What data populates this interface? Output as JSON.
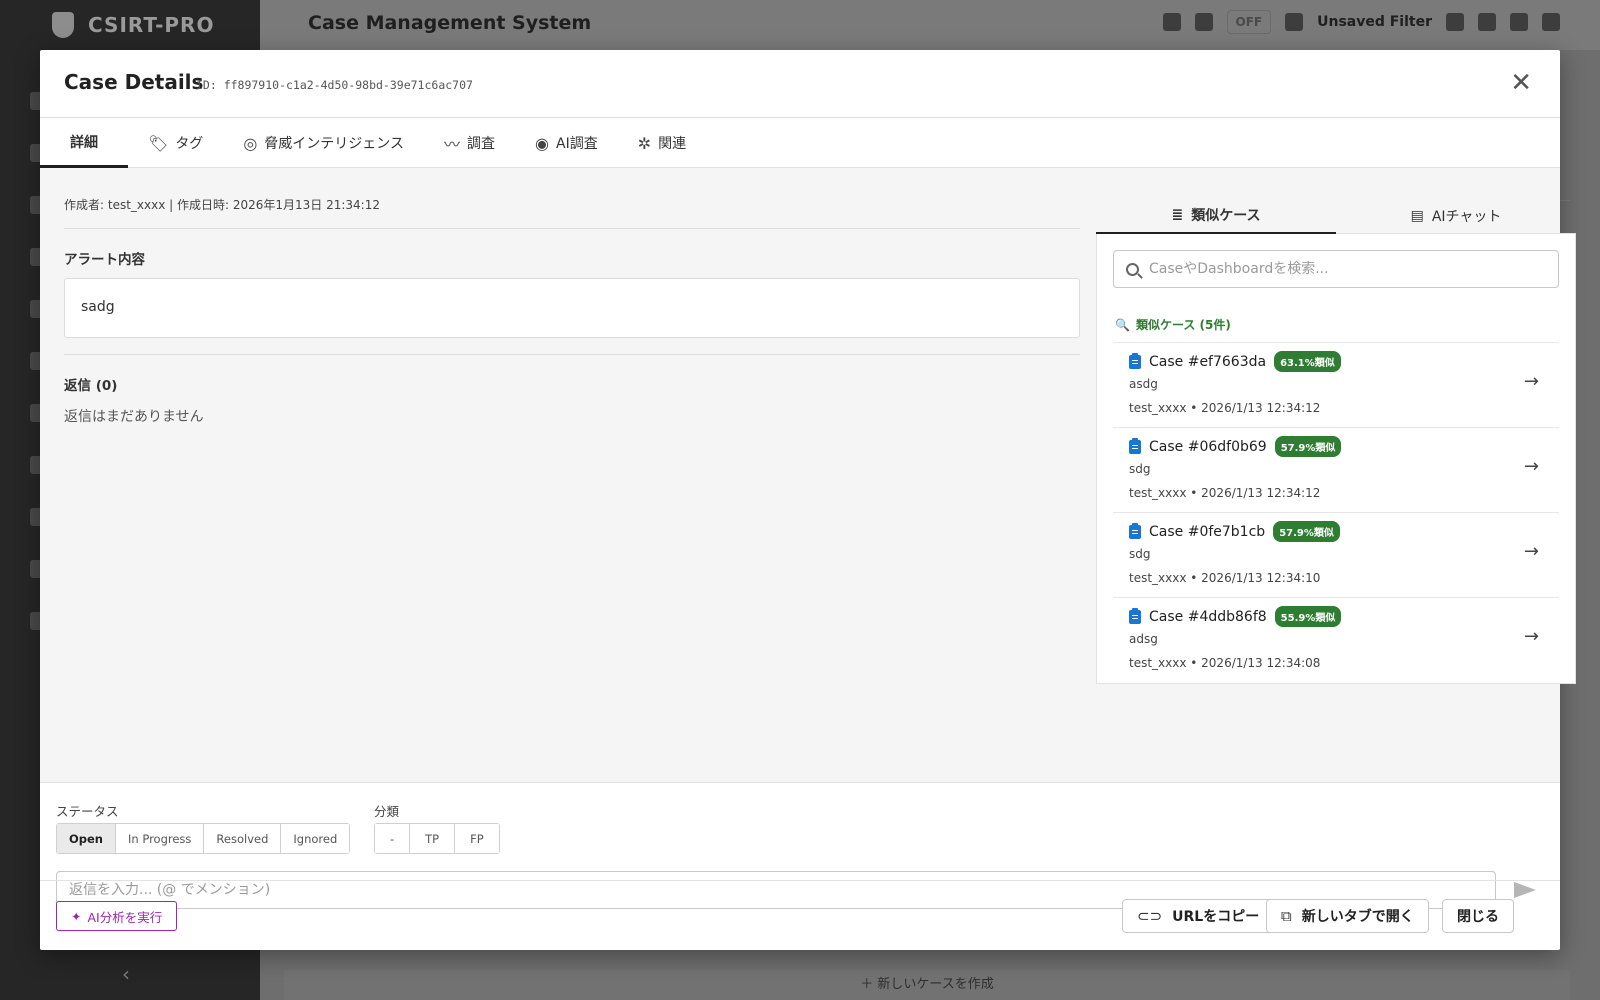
{
  "app": {
    "brand": "CSIRT-PRO",
    "title": "Case Management System",
    "toggle_label": "OFF",
    "filter_label": "Unsaved Filter",
    "create_case_label": "＋ 新しいケースを作成"
  },
  "modal": {
    "title": "Case Details",
    "case_id": "ID: ff897910-c1a2-4d50-98bd-39e71c6ac707",
    "tabs": [
      {
        "label": "詳細",
        "icon": "none"
      },
      {
        "label": "タグ",
        "icon": "tag-icon"
      },
      {
        "label": "脅威インテリジェンス",
        "icon": "target-icon"
      },
      {
        "label": "調査",
        "icon": "trend-icon"
      },
      {
        "label": "AI調査",
        "icon": "brain-icon"
      },
      {
        "label": "関連",
        "icon": "hub-icon"
      }
    ],
    "meta": "作成者: test_xxxx | 作成日時: 2026年1月13日 21:34:12",
    "alert_label": "アラート内容",
    "alert_content": "sadg",
    "replies_label": "返信 (0)",
    "replies_empty": "返信はまだありません"
  },
  "right_panel": {
    "tabs": [
      {
        "label": "類似ケース",
        "icon": "similar-search-icon"
      },
      {
        "label": "AIチャット",
        "icon": "chat-icon"
      }
    ],
    "search_placeholder": "CaseやDashboardを検索...",
    "similar_header": "類似ケース (5件)",
    "cases": [
      {
        "title": "Case #ef7663da",
        "badge": "63.1%類似",
        "summary": "asdg",
        "meta": "test_xxxx • 2026/1/13 12:34:12"
      },
      {
        "title": "Case #06df0b69",
        "badge": "57.9%類似",
        "summary": "sdg",
        "meta": "test_xxxx • 2026/1/13 12:34:12"
      },
      {
        "title": "Case #0fe7b1cb",
        "badge": "57.9%類似",
        "summary": "sdg",
        "meta": "test_xxxx • 2026/1/13 12:34:10"
      },
      {
        "title": "Case #4ddb86f8",
        "badge": "55.9%類似",
        "summary": "adsg",
        "meta": "test_xxxx • 2026/1/13 12:34:08"
      }
    ]
  },
  "controls": {
    "status_label": "ステータス",
    "status_options": [
      "Open",
      "In Progress",
      "Resolved",
      "Ignored"
    ],
    "status_selected": "Open",
    "class_label": "分類",
    "class_options": [
      "-",
      "TP",
      "FP"
    ],
    "reply_placeholder": "返信を入力... (@ でメンション)"
  },
  "footer": {
    "ai_button": "AI分析を実行",
    "copy_url": "URLをコピー",
    "open_tab": "新しいタブで開く",
    "close": "閉じる"
  },
  "colors": {
    "accent_green": "#2e7d32",
    "ai_purple": "#9c27b0",
    "case_icon_blue": "#1976d2"
  }
}
